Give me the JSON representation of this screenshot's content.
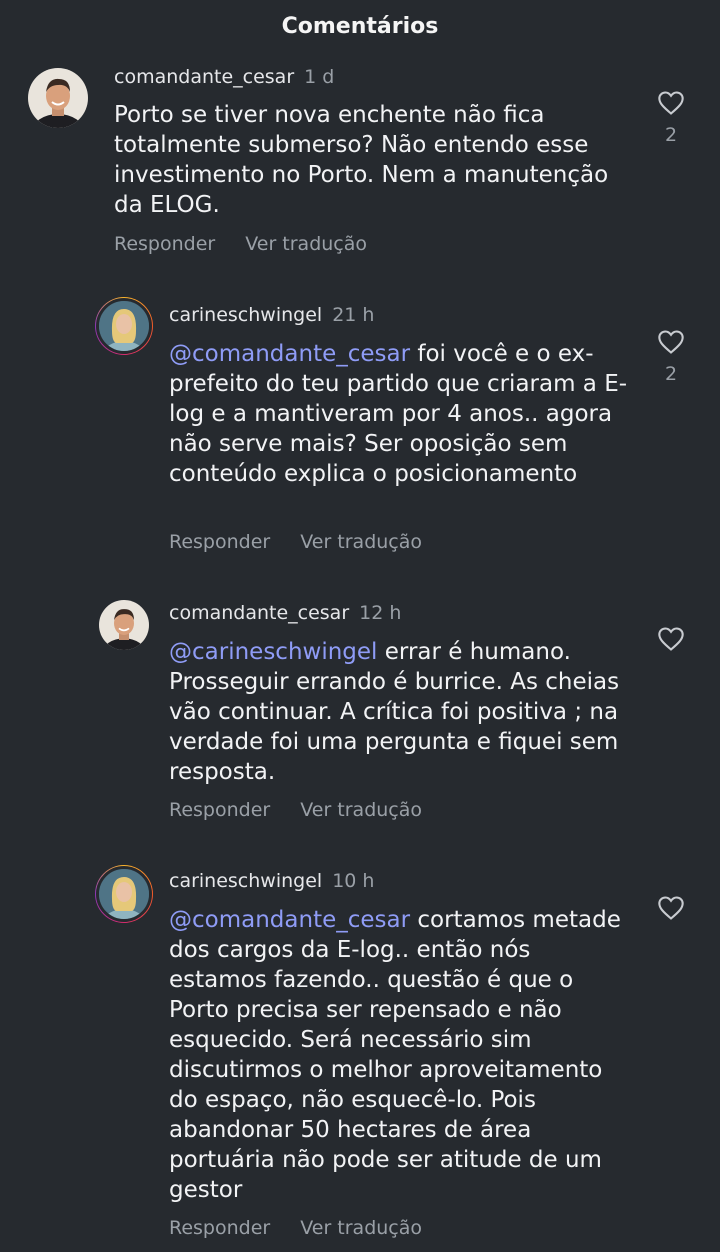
{
  "header": {
    "title": "Comentários"
  },
  "actions": {
    "reply": "Responder",
    "translate": "Ver tradução"
  },
  "comments": [
    {
      "username": "comandante_cesar",
      "time": "1 d",
      "mention": "",
      "text": "Porto se tiver nova enchente não fica totalmente submerso? Não entendo esse investimento no Porto. Nem a manutenção da ELOG.",
      "likes": "2"
    },
    {
      "username": "carineschwingel",
      "time": "21 h",
      "mention": "@comandante_cesar",
      "text": " foi você e o ex-prefeito do teu partido que criaram a E-log e a mantiveram por 4 anos.. agora não serve mais? Ser oposição sem conteúdo explica o posicionamento",
      "likes": "2"
    },
    {
      "username": "comandante_cesar",
      "time": "12 h",
      "mention": "@carineschwingel",
      "text": " errar é humano. Prosseguir errando é burrice. As cheias vão continuar. A crítica foi positiva ; na verdade foi uma pergunta e fiquei sem resposta.",
      "likes": ""
    },
    {
      "username": "carineschwingel",
      "time": "10 h",
      "mention": "@comandante_cesar",
      "text": " cortamos metade dos cargos da E-log.. então nós estamos fazendo.. questão é que o Porto precisa ser repensado e não esquecido. Será necessário sim discutirmos o melhor aproveitamento do espaço, não esquecê-lo. Pois abandonar 50 hectares de área portuária não pode ser atitude de um gestor",
      "likes": ""
    }
  ],
  "colors": {
    "background": "#262a2f",
    "mention": "#8f9cf6",
    "muted": "#9aa0a7"
  }
}
